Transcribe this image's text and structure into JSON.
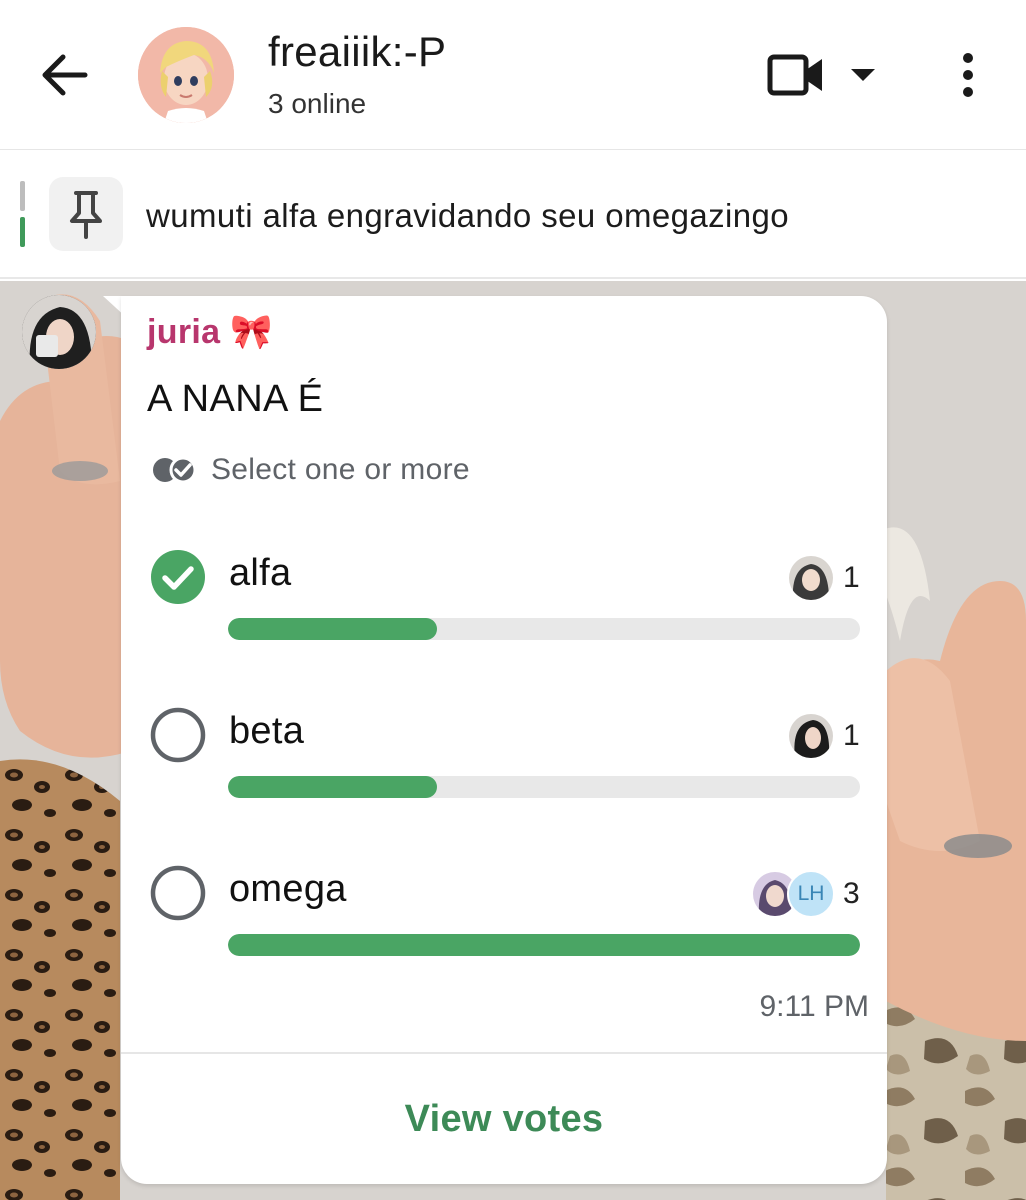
{
  "header": {
    "title": "freaiiik:-P",
    "subtitle": "3 online",
    "icons": {
      "back": "arrow-left-icon",
      "video": "video-camera-icon",
      "dropdown": "caret-down-icon",
      "more": "more-vertical-icon"
    }
  },
  "pinned": {
    "text": "wumuti alfa engravidando seu omegazingo",
    "icon": "pin-icon"
  },
  "message": {
    "sender": "juria 🎀",
    "time": "9:11 PM",
    "poll": {
      "question": "A NANA É",
      "hint": "Select one or more",
      "options": [
        {
          "label": "alfa",
          "count": "1",
          "selected": true,
          "fraction": 0.33
        },
        {
          "label": "beta",
          "count": "1",
          "selected": false,
          "fraction": 0.33
        },
        {
          "label": "omega",
          "count": "3",
          "selected": false,
          "fraction": 1.0,
          "voter_initials": "LH"
        }
      ],
      "view_votes_label": "View votes"
    }
  },
  "colors": {
    "accent_green": "#4aa564",
    "sender_name": "#b8366d",
    "view_votes": "#3d8a57"
  }
}
